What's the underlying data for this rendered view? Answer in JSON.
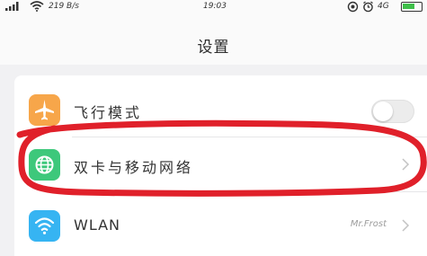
{
  "status_bar": {
    "signal_text": "ııl",
    "speed": "219 B/s",
    "time": "19:03",
    "network": "4G"
  },
  "header": {
    "title": "设置"
  },
  "settings": [
    {
      "label": "飞行模式",
      "icon": "airplane-icon",
      "control": "toggle",
      "toggle_on": false
    },
    {
      "label": "双卡与移动网络",
      "icon": "globe-icon",
      "control": "chevron"
    },
    {
      "label": "WLAN",
      "icon": "wifi-icon",
      "value": "Mr.Frost",
      "control": "chevron"
    }
  ],
  "colors": {
    "airplane_icon_bg": "#f7a64a",
    "globe_icon_bg": "#3dc87b",
    "wifi_icon_bg": "#36b4f2",
    "annotation": "#e0202a"
  }
}
